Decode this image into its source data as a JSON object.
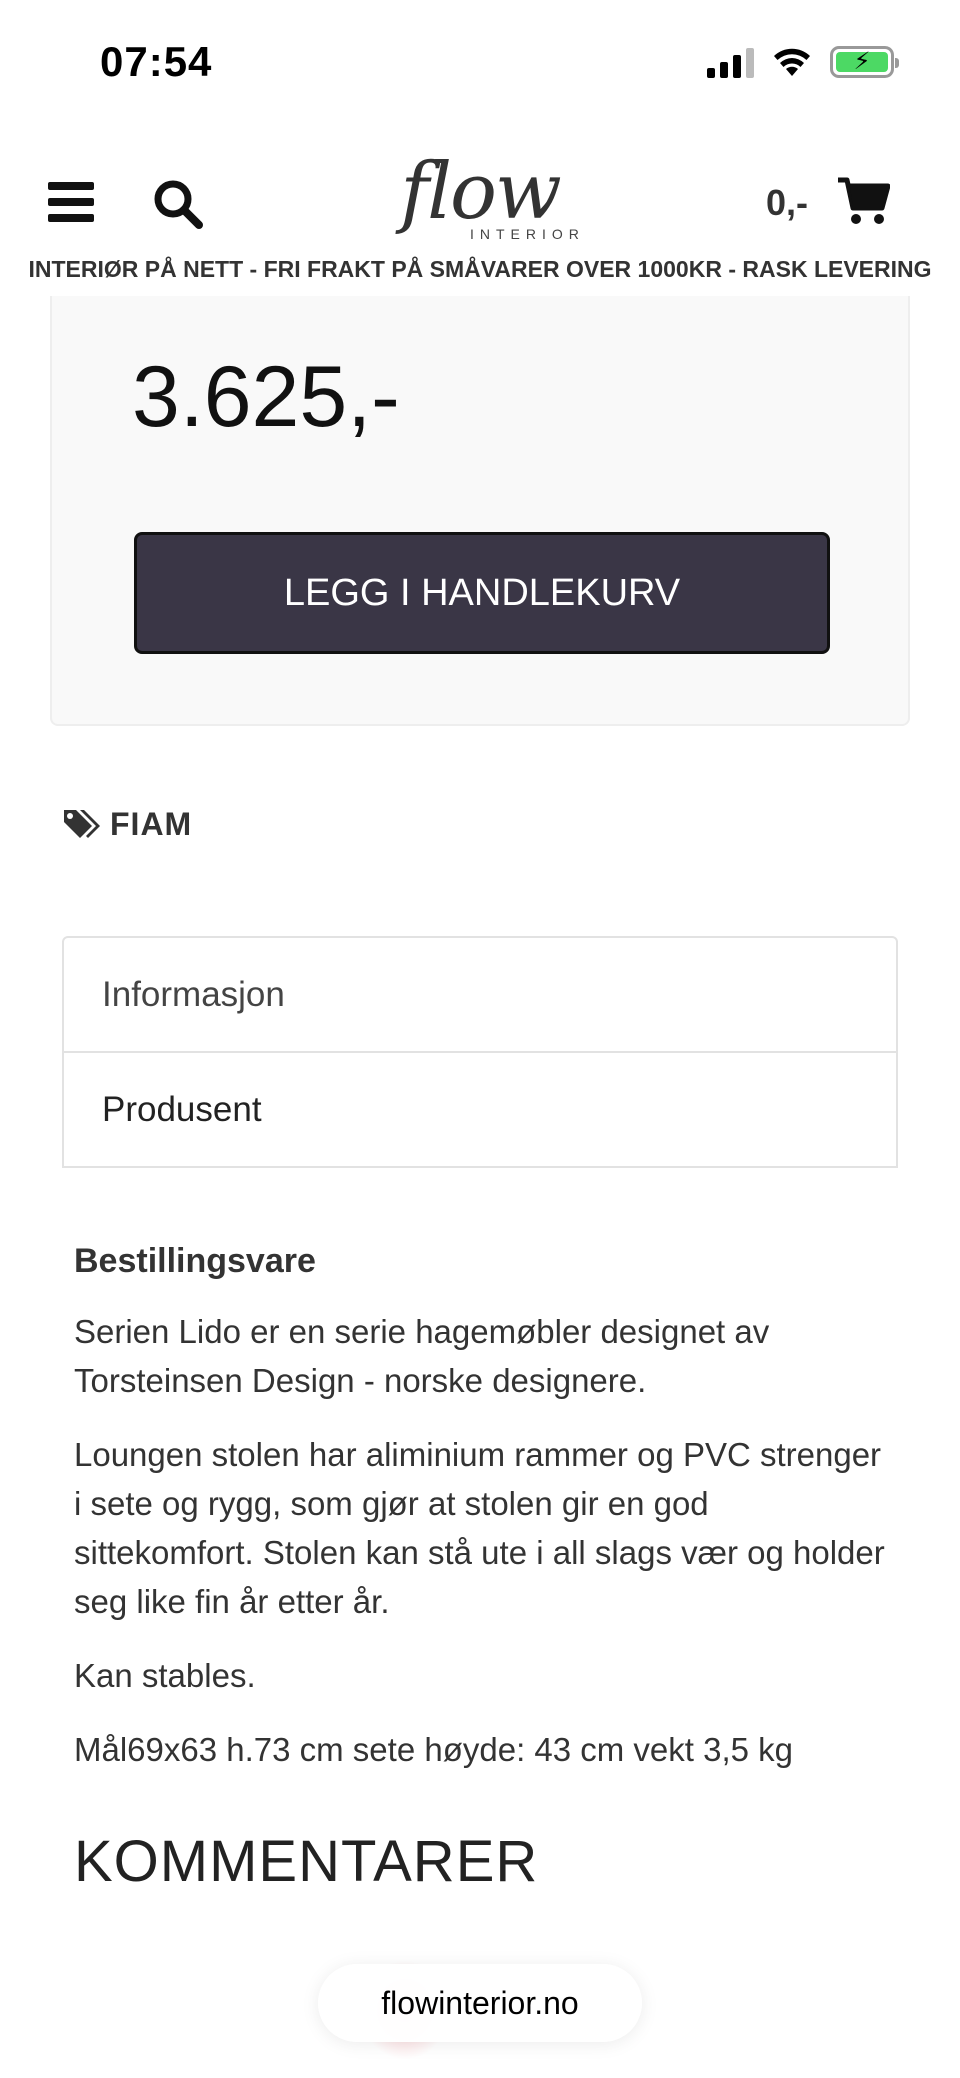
{
  "status_bar": {
    "time": "07:54",
    "icons": [
      "cellular-signal-icon",
      "wifi-icon",
      "battery-charging-icon"
    ]
  },
  "header": {
    "menu_icon": "hamburger-menu-icon",
    "search_icon": "search-icon",
    "logo": {
      "word": "flow",
      "sub": "INTERIOR"
    },
    "cart_total": "0,-",
    "cart_icon": "shopping-cart-icon"
  },
  "tagline": "INTERIØR PÅ NETT - FRI FRAKT PÅ SMÅVARER OVER 1000KR - RASK LEVERING",
  "product": {
    "price": "3.625,-",
    "add_to_cart_label": "LEGG I HANDLEKURV",
    "brand": "FIAM",
    "brand_icon": "tags-icon"
  },
  "tabs": [
    {
      "label": "Informasjon"
    },
    {
      "label": "Produsent"
    }
  ],
  "description": {
    "heading": "Bestillingsvare",
    "paragraphs": [
      "Serien Lido er en serie hagemøbler designet av Torsteinsen Design - norske designere.",
      "Loungen stolen har aliminium rammer og PVC strenger i sete og rygg, som gjør at stolen gir en god sittekomfort. Stolen kan stå ute i all slags vær og holder seg like fin år etter år.",
      "Kan stables.",
      "Mål69x63 h.73 cm sete høyde: 43 cm vekt 3,5 kg"
    ]
  },
  "comments_heading": "KOMMENTARER",
  "url_bar": {
    "domain": "flowinterior.no"
  },
  "colors": {
    "button_bg": "#3a3646",
    "price_box_bg": "#f9f9f9",
    "battery_green": "#4cd964"
  }
}
